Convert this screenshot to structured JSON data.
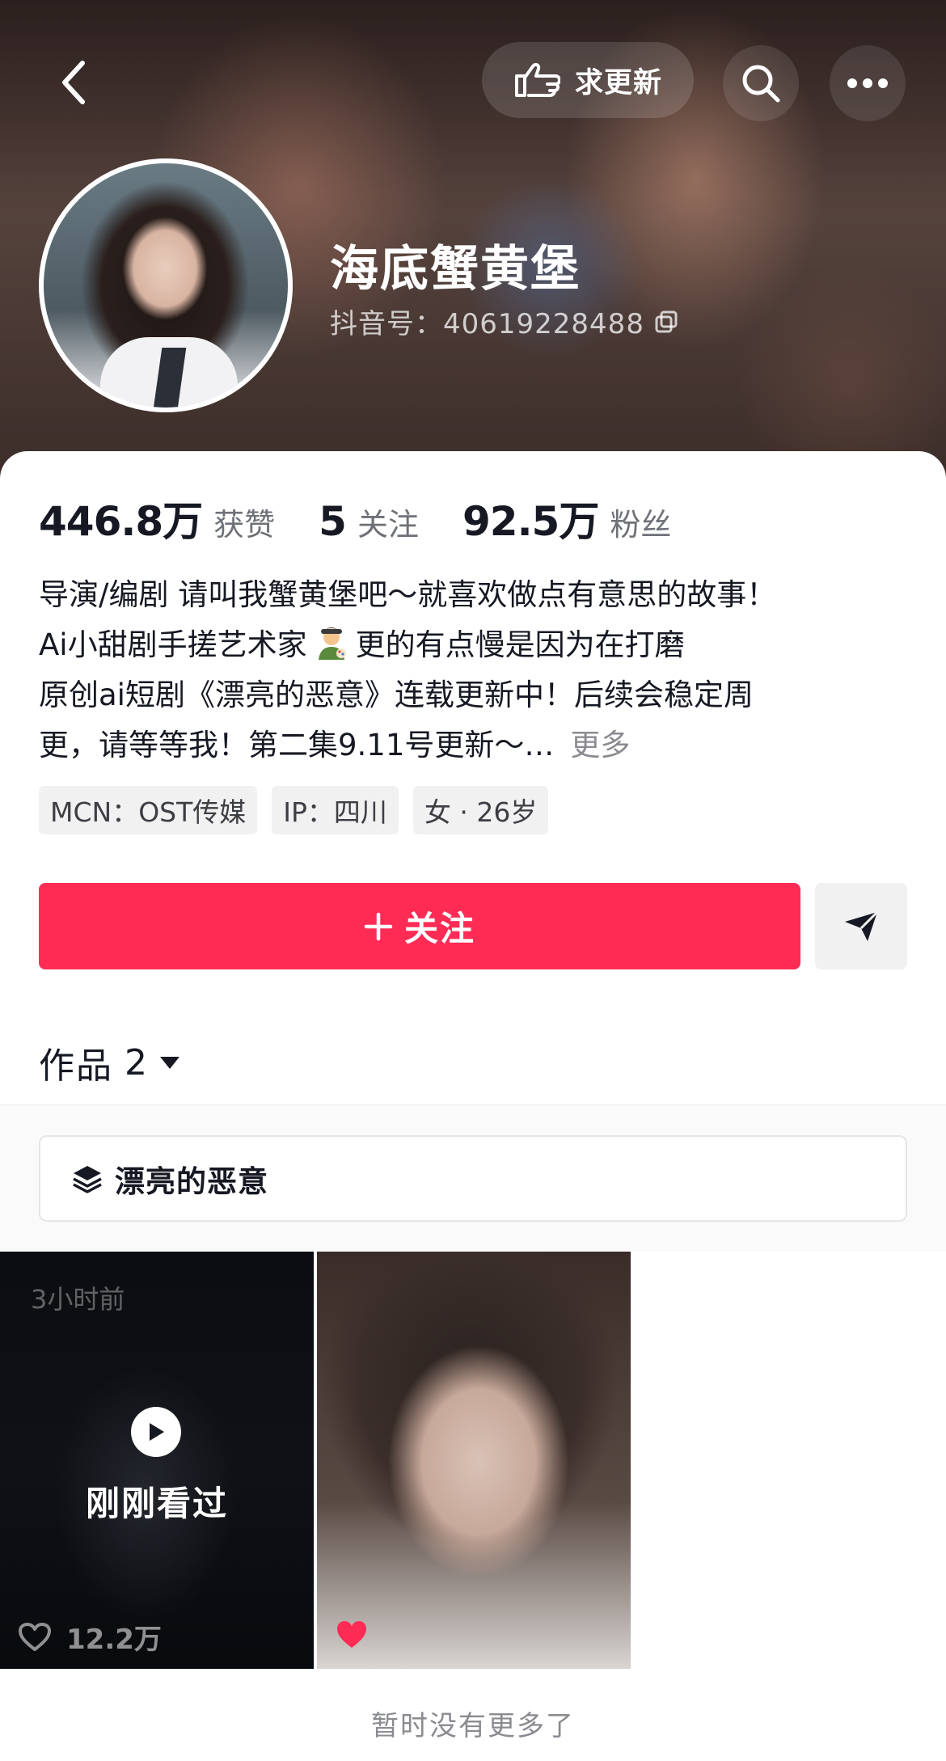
{
  "header": {
    "request_update_label": "求更新",
    "display_name": "海底蟹黄堡",
    "douyin_id": "抖音号：40619228488"
  },
  "stats": {
    "likes": {
      "value": "446.8万",
      "label": "获赞"
    },
    "following": {
      "value": "5",
      "label": "关注"
    },
    "followers": {
      "value": "92.5万",
      "label": "粉丝"
    }
  },
  "bio": {
    "line1": "导演/编剧 请叫我蟹黄堡吧～就喜欢做点有意思的故事！",
    "line2a": "Ai小甜剧手搓艺术家",
    "line2b": "更的有点慢是因为在打磨",
    "line3": "原创ai短剧《漂亮的恶意》连载更新中！后续会稳定周",
    "line4": "更，请等等我！第二集9.11号更新～…",
    "more_label": "更多"
  },
  "tags": [
    "MCN：OST传媒",
    "IP：四川",
    "女 · 26岁"
  ],
  "actions": {
    "follow_label": "关注"
  },
  "works": {
    "label": "作品",
    "count": "2"
  },
  "collection": {
    "label": "漂亮的恶意"
  },
  "videos": [
    {
      "time_ago": "3小时前",
      "status": "刚刚看过",
      "likes": "12.2万"
    },
    {
      "liked": true
    }
  ],
  "footer": {
    "note": "暂时没有更多了"
  },
  "colors": {
    "follow_button": "#fe2c55",
    "liked_heart": "#fe2c55"
  }
}
